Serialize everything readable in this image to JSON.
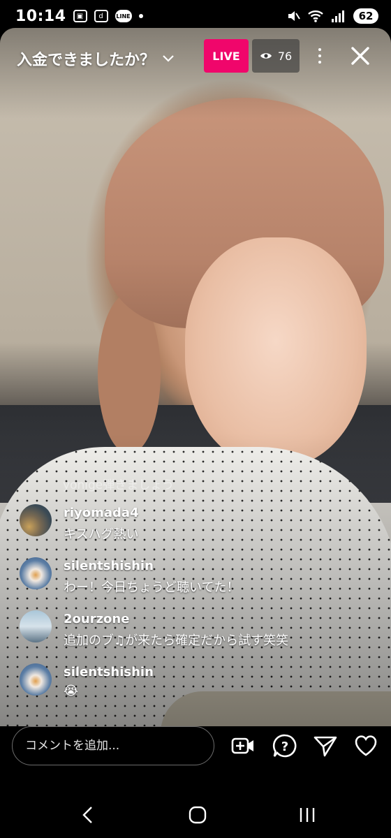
{
  "status_bar": {
    "time": "10:14",
    "app_icon_letter": "d",
    "line_label": "LINE",
    "battery": "62"
  },
  "stream": {
    "title": "入金できましたか？",
    "live_label": "LIVE",
    "viewer_count": "76"
  },
  "faded_comment": "yonige弾きましょう",
  "comments": [
    {
      "user": "riyomada4",
      "text": "キスハグ熱い",
      "avatar": "av-a"
    },
    {
      "user": "silentshishin",
      "text": "わー！今日ちょうど聴いてた！",
      "avatar": "av-b"
    },
    {
      "user": "2ourzone",
      "text": "追加のブ♫が来たら確定だから試す笑笑",
      "avatar": "av-c"
    },
    {
      "user": "silentshishin",
      "text": "😭",
      "avatar": "av-b"
    }
  ],
  "composer": {
    "placeholder": "コメントを追加..."
  },
  "colors": {
    "live": "#f0066b",
    "viewer_badge": "#3c3c3c"
  },
  "icons": [
    "chevron-down-icon",
    "eye-icon",
    "more-icon",
    "close-icon",
    "add-media-icon",
    "question-icon",
    "send-icon",
    "heart-icon",
    "back-icon",
    "home-icon",
    "recents-icon"
  ]
}
